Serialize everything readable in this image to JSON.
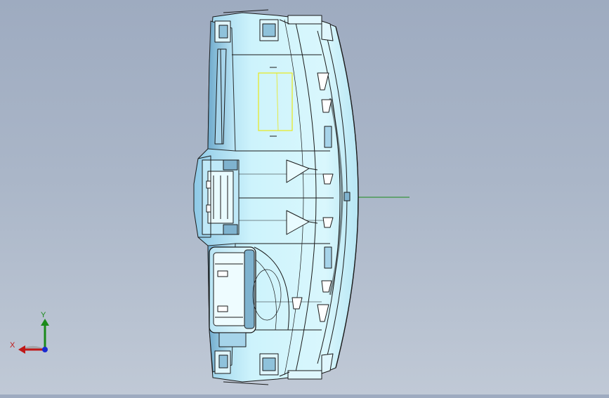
{
  "viewport": {
    "background_top": "#9eabc0",
    "background_bottom": "#c0c9d6",
    "model_fill": "#c9f1fb",
    "model_stroke": "#1a1a1a",
    "highlight_color": "#e8e81a",
    "axis_line_color": "#1a8a1a"
  },
  "triad": {
    "x_label": "X",
    "y_label": "Y",
    "x_color": "#c01818",
    "y_color": "#1a8a1a",
    "z_color": "#1a2ad0"
  }
}
